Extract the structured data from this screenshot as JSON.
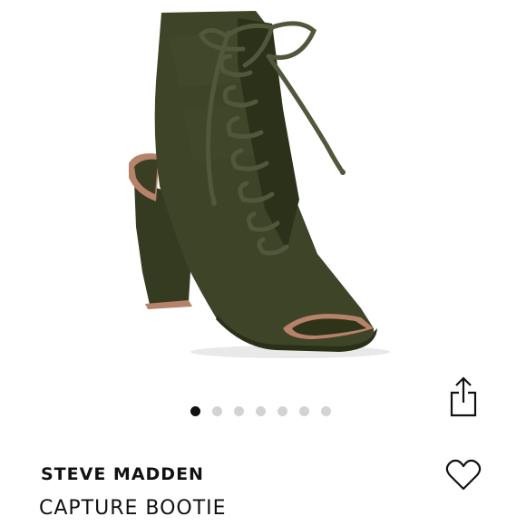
{
  "product": {
    "brand": "STEVE MADDEN",
    "name": "CAPTURE BOOTIE"
  },
  "gallery": {
    "image_count": 7,
    "active_index": 0,
    "image_subject": "olive green knit peep-toe lace-up block heel bootie"
  },
  "icons": {
    "share": "share-icon",
    "favorite": "heart-icon"
  },
  "colors": {
    "shoe": "#3d4427",
    "shoe_dark": "#2c3119",
    "lining": "#b6826a",
    "dot_active": "#111111",
    "dot_inactive": "#d3d3d3",
    "text": "#111111"
  }
}
